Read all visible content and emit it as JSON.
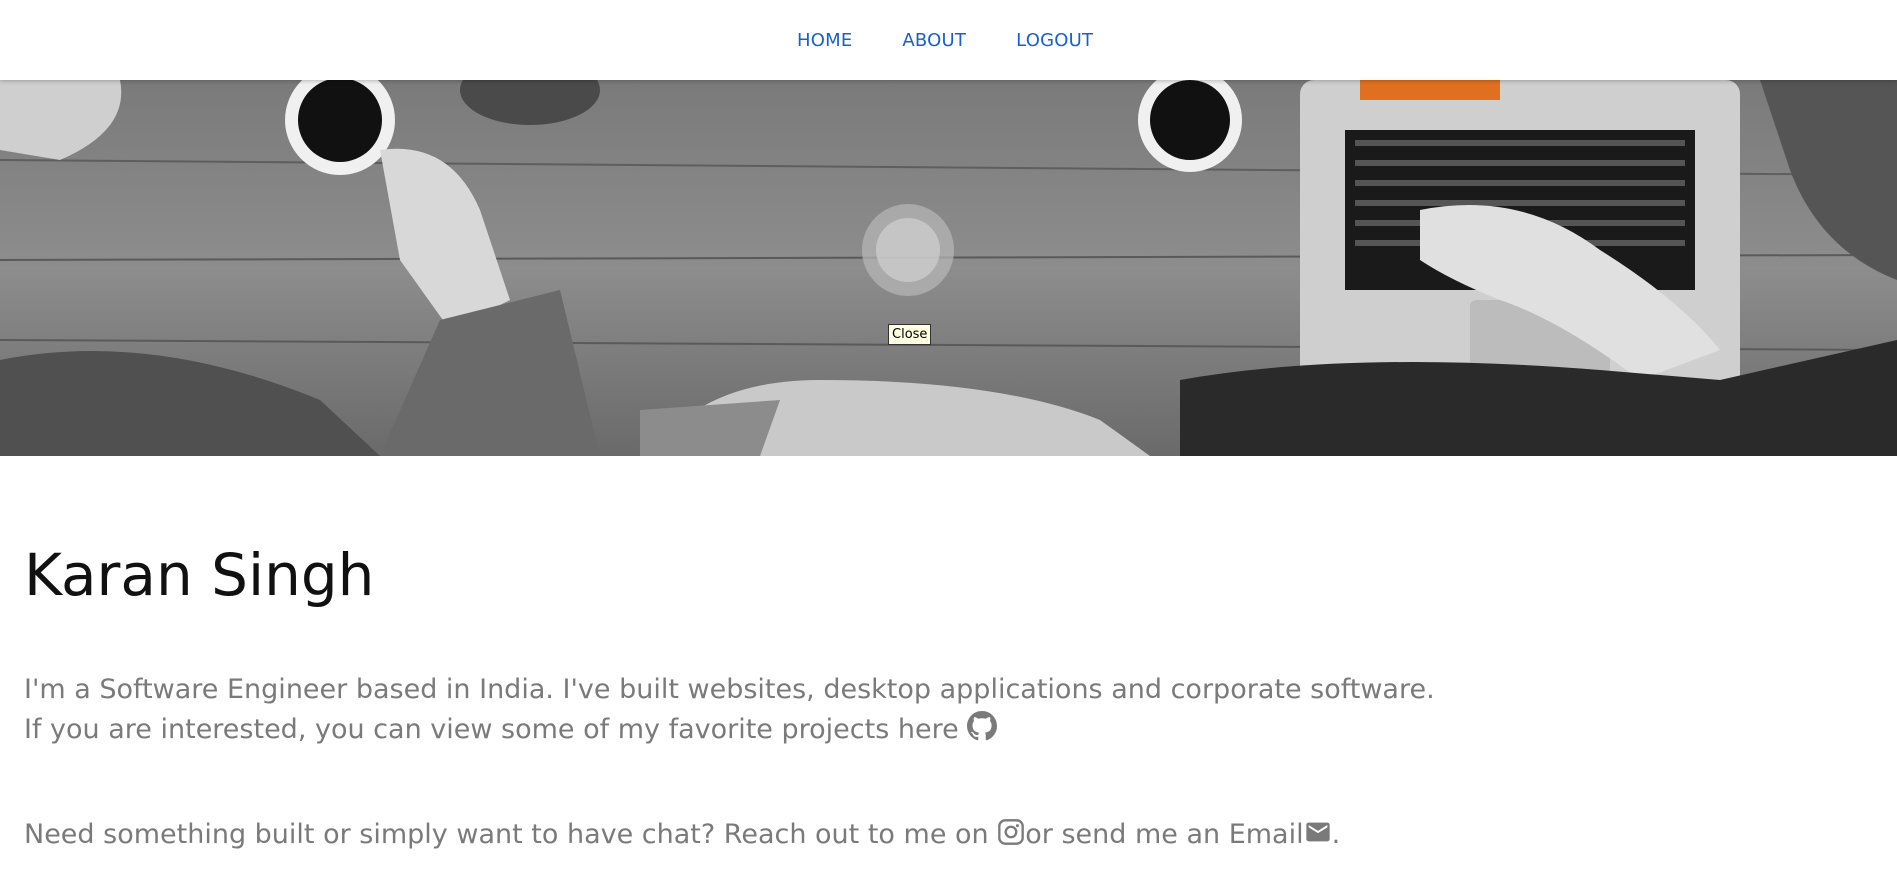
{
  "nav": {
    "home": "HOME",
    "about": "ABOUT",
    "logout": "LOGOUT"
  },
  "hero": {
    "image": "black-and-white-desk-with-coffee-and-laptop",
    "tooltip": "Close"
  },
  "profile": {
    "name": "Karan Singh",
    "intro_line1": "I'm a Software Engineer based in India. I've built websites, desktop applications and corporate software.",
    "intro_line2": "If you are interested, you can view some of my favorite projects here",
    "contact_part1": "Need something built or simply want to have chat? Reach out to me on ",
    "contact_part2": "or send me an Email",
    "contact_end": "."
  },
  "icons": {
    "github": "github-icon",
    "instagram": "instagram-icon",
    "email": "email-icon"
  },
  "colors": {
    "nav_link": "#1a5fd0",
    "body_text": "#7a7a7a",
    "heading": "#111111",
    "icon": "#7a7a7a"
  }
}
